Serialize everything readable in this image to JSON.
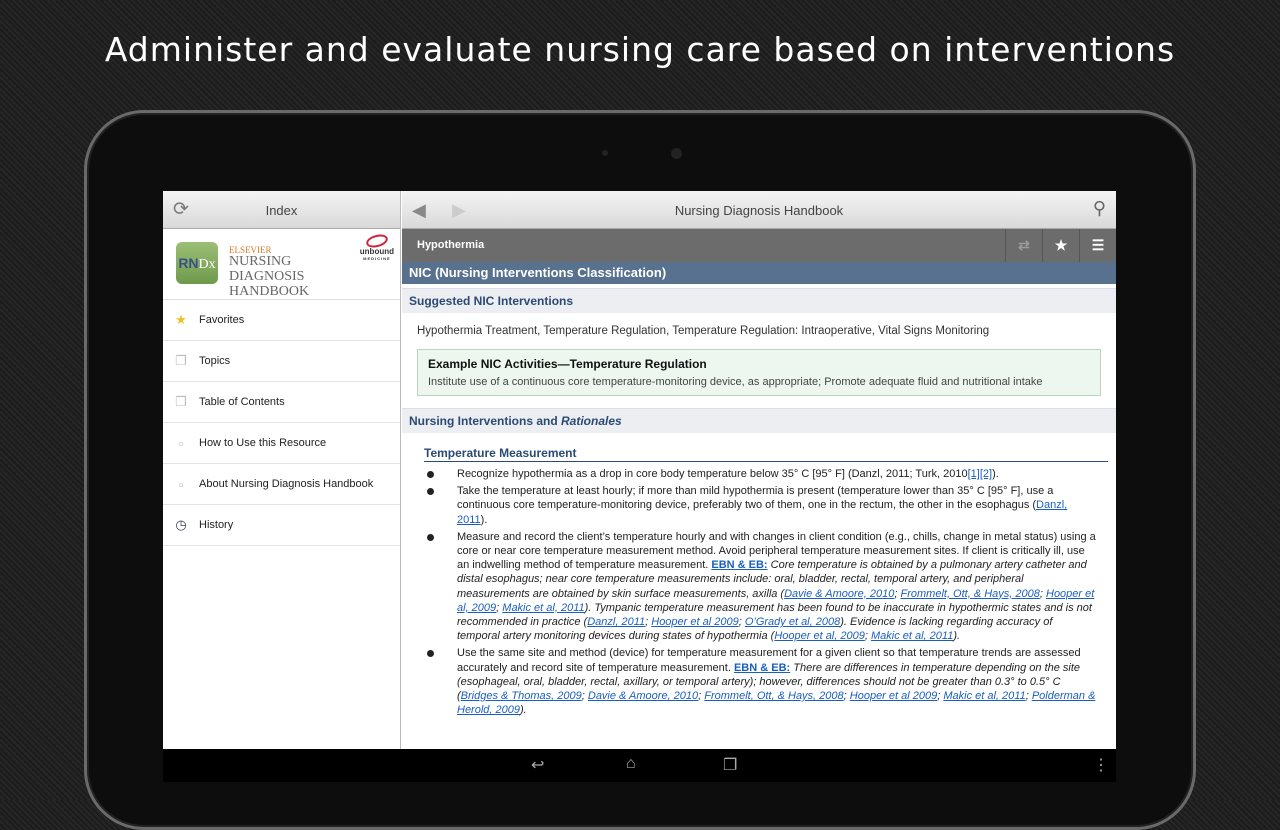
{
  "promo_title": "Administer and evaluate nursing care based on interventions",
  "left": {
    "header": "Index",
    "logo": {
      "rndx": "RNDx",
      "publisher": "ELSEVIER",
      "title": "NURSING DIAGNOSIS HANDBOOK",
      "brand": "unbound",
      "brand_sub": "MEDICINE"
    },
    "items": [
      {
        "label": "Favorites",
        "icon": "star-icon"
      },
      {
        "label": "Topics",
        "icon": "pages-icon"
      },
      {
        "label": "Table of Contents",
        "icon": "pages-icon"
      },
      {
        "label": "How to Use this Resource",
        "icon": "page-icon"
      },
      {
        "label": "About Nursing Diagnosis Handbook",
        "icon": "page-icon"
      },
      {
        "label": "History",
        "icon": "clock-icon"
      }
    ]
  },
  "right": {
    "header": "Nursing Diagnosis Handbook",
    "topic": "Hypothermia",
    "section": "NIC (Nursing Interventions Classification)",
    "suggested_heading": "Suggested NIC Interventions",
    "suggested_text": "Hypothermia Treatment, Temperature Regulation, Temperature Regulation: Intraoperative, Vital Signs Monitoring",
    "example_heading": "Example NIC Activities—Temperature Regulation",
    "example_text": "Institute use of a continuous core temperature-monitoring device, as appropriate; Promote adequate fluid and nutritional intake",
    "interventions_heading": "Nursing Interventions and ",
    "interventions_heading_italic": "Rationales",
    "subheading": "Temperature Measurement",
    "bullets": [
      [
        {
          "t": "Recognize hypothermia as a drop in core body temperature below 35° C [95° F] (Danzl, 2011; Turk, 2010",
          "s": "n"
        },
        {
          "t": "[1][2]",
          "s": "l"
        },
        {
          "t": ").",
          "s": "n"
        }
      ],
      [
        {
          "t": "Take the temperature at least hourly; if more than mild hypothermia is present (temperature lower than 35° C [95° F], use a continuous core temperature-monitoring device, preferably two of them, one in the rectum, the other in the esophagus (",
          "s": "n"
        },
        {
          "t": "Danzl, 2011",
          "s": "l"
        },
        {
          "t": ").",
          "s": "n"
        }
      ],
      [
        {
          "t": "Measure and record the client’s temperature hourly and with changes in client condition (e.g., chills, change in metal status) using a core or near core temperature measurement method. Avoid peripheral temperature measurement sites. If client is critically ill, use an indwelling method of temperature measurement. ",
          "s": "n"
        },
        {
          "t": "EBN & EB:",
          "s": "b"
        },
        {
          "t": " Core temperature is obtained by a pulmonary artery catheter and distal esophagus; near core temperature measurements include: oral, bladder, rectal, temporal artery, and peripheral measurements are obtained by skin surface measurements, axilla (",
          "s": "i"
        },
        {
          "t": "Davie & Amoore, 2010",
          "s": "li"
        },
        {
          "t": "; ",
          "s": "i"
        },
        {
          "t": "Frommelt, Ott, & Hays, 2008",
          "s": "li"
        },
        {
          "t": "; ",
          "s": "i"
        },
        {
          "t": "Hooper et al, 2009",
          "s": "li"
        },
        {
          "t": "; ",
          "s": "i"
        },
        {
          "t": "Makic et al, 2011",
          "s": "li"
        },
        {
          "t": "). Tympanic temperature measurement has been found to be inaccurate in hypothermic states and is not recommended in practice (",
          "s": "i"
        },
        {
          "t": "Danzl, 2011",
          "s": "li"
        },
        {
          "t": "; ",
          "s": "i"
        },
        {
          "t": "Hooper et al 2009",
          "s": "li"
        },
        {
          "t": "; ",
          "s": "i"
        },
        {
          "t": "O’Grady et al, 2008",
          "s": "li"
        },
        {
          "t": "). Evidence is lacking regarding accuracy of temporal artery monitoring devices during states of hypothermia (",
          "s": "i"
        },
        {
          "t": "Hooper et al, 2009",
          "s": "li"
        },
        {
          "t": "; ",
          "s": "i"
        },
        {
          "t": "Makic et al, 2011",
          "s": "li"
        },
        {
          "t": ").",
          "s": "i"
        }
      ],
      [
        {
          "t": "Use the same site and method (device) for temperature measurement for a given client so that temperature trends are assessed accurately and record site of temperature measurement. ",
          "s": "n"
        },
        {
          "t": "EBN & EB:",
          "s": "b"
        },
        {
          "t": " There are differences in temperature depending on the site (esophageal, oral, bladder, rectal, axillary, or temporal artery); however, differences should not be greater than 0.3° to 0.5° C (",
          "s": "i"
        },
        {
          "t": "Bridges & Thomas, 2009",
          "s": "li"
        },
        {
          "t": "; ",
          "s": "i"
        },
        {
          "t": "Davie & Amoore, 2010",
          "s": "li"
        },
        {
          "t": "; ",
          "s": "i"
        },
        {
          "t": "Frommelt, Ott, & Hays, 2008",
          "s": "li"
        },
        {
          "t": "; ",
          "s": "i"
        },
        {
          "t": "Hooper et al 2009",
          "s": "li"
        },
        {
          "t": "; ",
          "s": "i"
        },
        {
          "t": "Makic et al, 2011",
          "s": "li"
        },
        {
          "t": "; ",
          "s": "i"
        },
        {
          "t": "Polderman & Herold, 2009",
          "s": "li"
        },
        {
          "t": ").",
          "s": "i"
        }
      ]
    ]
  },
  "colors": {
    "section_bar": "#58718e",
    "link": "#1a5fc0",
    "topic_bar": "#6c6c6c"
  }
}
